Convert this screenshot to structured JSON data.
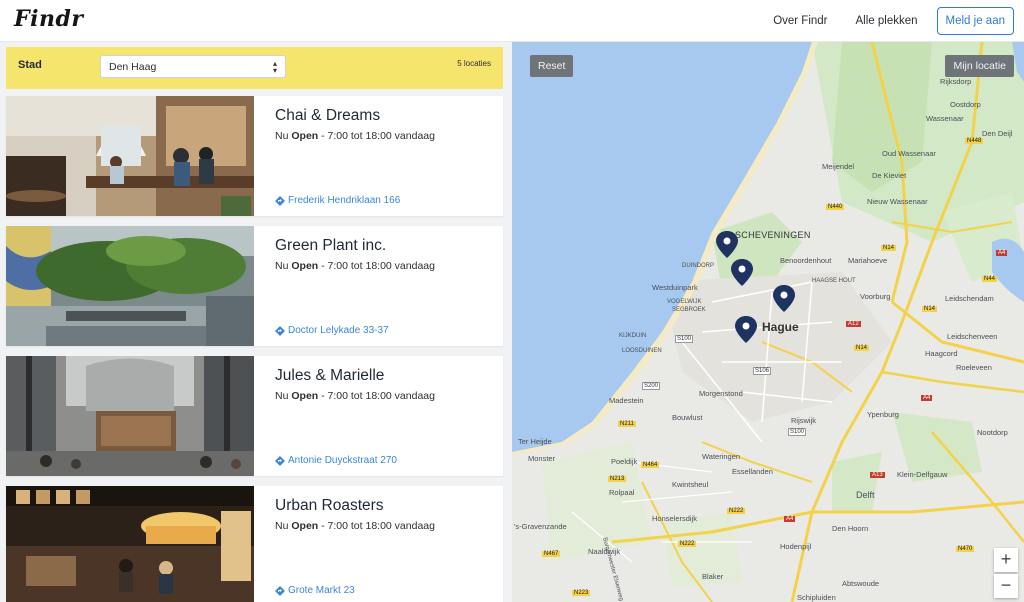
{
  "header": {
    "logo": "Findr",
    "nav": {
      "about": "Over Findr",
      "all_places": "Alle plekken",
      "signup": "Meld je aan"
    }
  },
  "filter": {
    "label": "Stad",
    "city_value": "Den Haag",
    "count": "5 locaties"
  },
  "cards": [
    {
      "title": "Chai & Dreams",
      "now": "Nu",
      "status": "Open",
      "hours": "- 7:00 tot 18:00 vandaag",
      "address": "Frederik Hendriklaan 166"
    },
    {
      "title": "Green Plant inc.",
      "now": "Nu",
      "status": "Open",
      "hours": "- 7:00 tot 18:00 vandaag",
      "address": "Doctor Lelykade 33-37"
    },
    {
      "title": "Jules & Marielle",
      "now": "Nu",
      "status": "Open",
      "hours": "- 7:00 tot 18:00 vandaag",
      "address": "Antonie Duyckstraat 270"
    },
    {
      "title": "Urban Roasters",
      "now": "Nu",
      "status": "Open",
      "hours": "- 7:00 tot 18:00 vandaag",
      "address": "Grote Markt 23"
    }
  ],
  "map": {
    "reset": "Reset",
    "my_location": "Mijn locatie",
    "zoom_in": "+",
    "zoom_out": "−",
    "labels": {
      "rijksdorp": "Rijksdorp",
      "oostdorp": "Oostdorp",
      "wassenaar": "Wassenaar",
      "den_deijl": "Den Deijl",
      "oud_wassenaar": "Oud Wassenaar",
      "meijendel": "Meijendel",
      "de_kieviet": "De Kieviet",
      "nieuw_wassenaar": "Nieuw Wassenaar",
      "scheveningen": "SCHEVENINGEN",
      "benoordenhout": "Benoordenhout",
      "mariahoeve": "Mariahoeve",
      "duindorp": "DUINDORP",
      "westduinpark": "Westduinpark",
      "vogelwijk": "VOGELWIJK",
      "segbroek": "SEGBROEK",
      "haagse_hout": "HAAGSE HOUT",
      "hague": "Hague",
      "voorburg": "Voorburg",
      "leidschendam": "Leidschendam",
      "leidschenveen": "Leidschenveen",
      "kijkduin": "KIJKDUIN",
      "loosduinen": "LOOSDUINEN",
      "haagcord": "Haagcord",
      "roeleveen": "Roeleveen",
      "madestein": "Madestein",
      "morgenstond": "Morgenstond",
      "rijswijk": "Rijswijk",
      "ypenburg": "Ypenburg",
      "ter_heijde": "Ter Heijde",
      "bouwlust": "Bouwlust",
      "nootdorp": "Nootdorp",
      "monster": "Monster",
      "poeldijk": "Poeldijk",
      "wateringen": "Wateringen",
      "kleindelfgauw": "Klein-Delfgauw",
      "esselanden": "Essellanden",
      "rolpaal": "Rolpaal",
      "kwintsheul": "Kwintsheul",
      "delft": "Delft",
      "gravenzande": "'s-Gravenzande",
      "honselersdijk": "Honselersdijk",
      "den_hoorn": "Den Hoorn",
      "hodenpijl": "Hodenpijl",
      "naaldwijk": "Naaldwijk",
      "blaker": "Blaker",
      "abtswoude": "Abtswoude",
      "schipluiden": "Schipluiden",
      "burgemeester": "Burgemeester Elsenweg"
    },
    "roads": [
      "N448",
      "N440",
      "N14",
      "A4",
      "N44",
      "N14",
      "A12",
      "N14",
      "S100",
      "S200",
      "S106",
      "S100",
      "N211",
      "N464",
      "N222",
      "N213",
      "A13",
      "N470",
      "A4",
      "N467",
      "N222",
      "A4",
      "N223"
    ]
  },
  "colors": {
    "accent": "#f6e56d",
    "link": "#3a86dc",
    "sea": "#a7c9f0",
    "pin": "#1e3361"
  }
}
